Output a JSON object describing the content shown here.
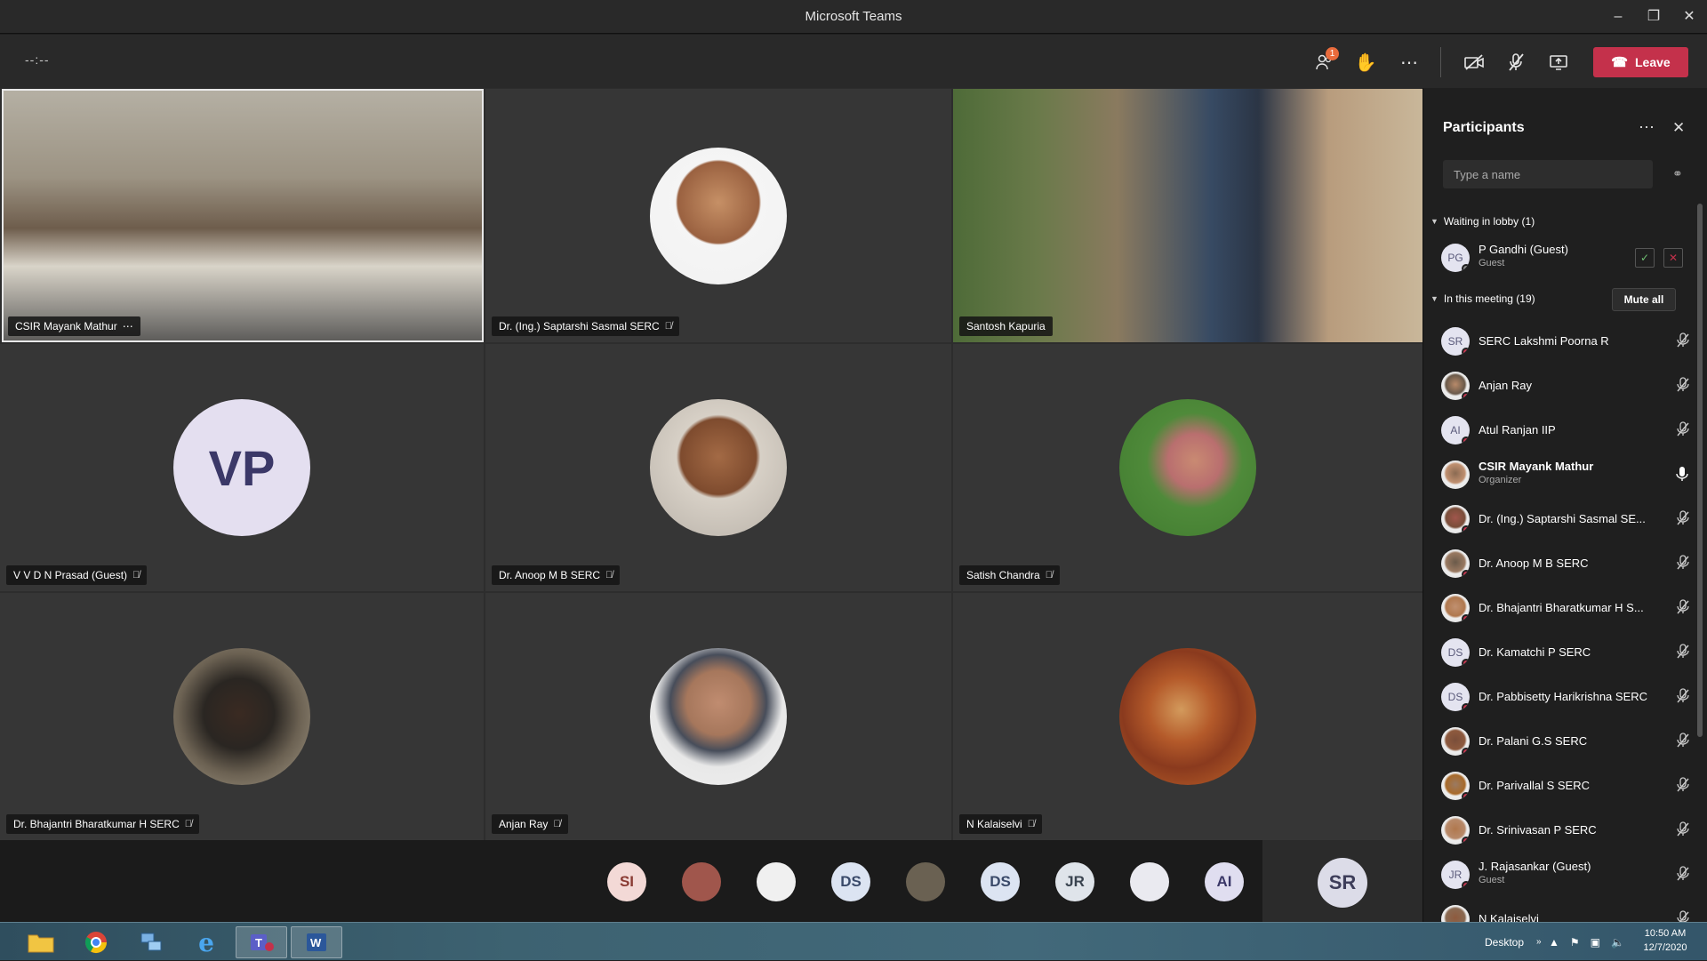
{
  "window": {
    "title": "Microsoft Teams"
  },
  "toolbar": {
    "timer": "--:--",
    "participants_badge": "1",
    "leave_label": "Leave"
  },
  "tiles": [
    {
      "name": "CSIR Mayank Mathur",
      "kind": "video-room",
      "muted": false
    },
    {
      "name": "Dr. (Ing.) Saptarshi Sasmal SERC",
      "kind": "photo",
      "muted": true
    },
    {
      "name": "Santosh Kapuria",
      "kind": "video-office",
      "muted": false
    },
    {
      "name": "V V D N Prasad (Guest)",
      "kind": "initials",
      "initials": "VP",
      "muted": true
    },
    {
      "name": "Dr. Anoop M B SERC",
      "kind": "photo",
      "muted": true
    },
    {
      "name": "Satish Chandra",
      "kind": "photo",
      "muted": true
    },
    {
      "name": "Dr. Bhajantri Bharatkumar H SERC",
      "kind": "photo",
      "muted": true
    },
    {
      "name": "Anjan Ray",
      "kind": "photo",
      "muted": true
    },
    {
      "name": "N Kalaiselvi",
      "kind": "photo",
      "muted": true
    }
  ],
  "strip": [
    {
      "initials": "SI",
      "bg": "#f3d9d6",
      "fg": "#8a3b33"
    },
    {
      "initials": "",
      "bg": "#a0564c",
      "fg": "#fff"
    },
    {
      "initials": "",
      "bg": "#f0f0f0",
      "fg": "#333"
    },
    {
      "initials": "DS",
      "bg": "#dce4f2",
      "fg": "#3a4a6a"
    },
    {
      "initials": "",
      "bg": "#6a6152",
      "fg": "#fff"
    },
    {
      "initials": "DS",
      "bg": "#dce4f2",
      "fg": "#3a4a6a"
    },
    {
      "initials": "JR",
      "bg": "#dfe4ea",
      "fg": "#3a4450"
    },
    {
      "initials": "",
      "bg": "#eaeaf0",
      "fg": "#333"
    },
    {
      "initials": "AI",
      "bg": "#e0def0",
      "fg": "#3b3868"
    }
  ],
  "strip_self": "SR",
  "panel": {
    "title": "Participants",
    "search_placeholder": "Type a name",
    "lobby_header": "Waiting in lobby (1)",
    "meeting_header": "In this meeting (19)",
    "mute_all": "Mute all",
    "lobby": [
      {
        "initials": "PG",
        "name": "P Gandhi (Guest)",
        "role": "Guest"
      }
    ],
    "members": [
      {
        "initials": "SR",
        "name": "SERC Lakshmi Poorna R",
        "role": "",
        "photo": false,
        "mic": "off"
      },
      {
        "initials": "",
        "name": "Anjan Ray",
        "role": "",
        "photo": true,
        "mic": "off"
      },
      {
        "initials": "AI",
        "name": "Atul Ranjan IIP",
        "role": "",
        "photo": false,
        "mic": "off"
      },
      {
        "initials": "",
        "name": "CSIR Mayank Mathur",
        "role": "Organizer",
        "photo": true,
        "mic": "on"
      },
      {
        "initials": "",
        "name": "Dr. (Ing.) Saptarshi Sasmal SE...",
        "role": "",
        "photo": true,
        "mic": "off"
      },
      {
        "initials": "",
        "name": "Dr. Anoop M B SERC",
        "role": "",
        "photo": true,
        "mic": "off"
      },
      {
        "initials": "",
        "name": "Dr. Bhajantri Bharatkumar H S...",
        "role": "",
        "photo": true,
        "mic": "off"
      },
      {
        "initials": "DS",
        "name": "Dr. Kamatchi P SERC",
        "role": "",
        "photo": false,
        "mic": "off"
      },
      {
        "initials": "DS",
        "name": "Dr. Pabbisetty Harikrishna SERC",
        "role": "",
        "photo": false,
        "mic": "off"
      },
      {
        "initials": "",
        "name": "Dr. Palani G.S SERC",
        "role": "",
        "photo": true,
        "mic": "off"
      },
      {
        "initials": "",
        "name": "Dr. Parivallal S SERC",
        "role": "",
        "photo": true,
        "mic": "off"
      },
      {
        "initials": "",
        "name": "Dr. Srinivasan P SERC",
        "role": "",
        "photo": true,
        "mic": "off"
      },
      {
        "initials": "JR",
        "name": "J. Rajasankar (Guest)",
        "role": "Guest",
        "photo": false,
        "mic": "off"
      },
      {
        "initials": "",
        "name": "N Kalaiselvi",
        "role": "",
        "photo": true,
        "mic": "off"
      }
    ]
  },
  "taskbar": {
    "desktop_label": "Desktop",
    "time": "10:50 AM",
    "date": "12/7/2020"
  },
  "colors": {
    "leave": "#c4314b",
    "badge": "#e96b3c",
    "bg": "#2d2d2d"
  }
}
